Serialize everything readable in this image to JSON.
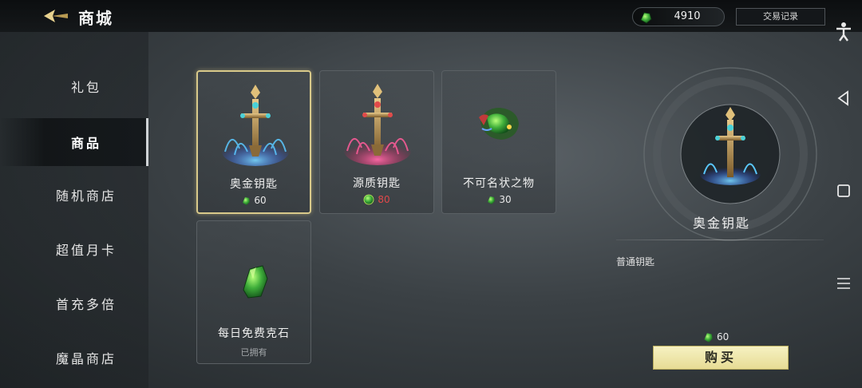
{
  "header": {
    "title": "商城",
    "currency_amount": "4910",
    "history_label": "交易记录"
  },
  "sidebar": {
    "items": [
      {
        "label": "礼包",
        "active": false
      },
      {
        "label": "商品",
        "active": true
      },
      {
        "label": "随机商店",
        "active": false
      },
      {
        "label": "超值月卡",
        "active": false
      },
      {
        "label": "首充多倍",
        "active": false
      },
      {
        "label": "魔晶商店",
        "active": false
      }
    ]
  },
  "items": [
    {
      "name": "奥金钥匙",
      "price": "60",
      "currency": "green-crystal",
      "selected": true
    },
    {
      "name": "源质钥匙",
      "price": "80",
      "currency": "green-orb",
      "price_color": "#e0484a"
    },
    {
      "name": "不可名状之物",
      "price": "30",
      "currency": "green-crystal"
    },
    {
      "name": "每日免费克石",
      "status": "已拥有"
    }
  ],
  "detail": {
    "name": "奥金钥匙",
    "description": "普通钥匙",
    "price": "60",
    "buy_label": "购买"
  },
  "colors": {
    "accent_gold": "#d8c98a",
    "buy_button": "#efe6aa",
    "price_red": "#e0484a",
    "crystal_green": "#3fae3a"
  }
}
